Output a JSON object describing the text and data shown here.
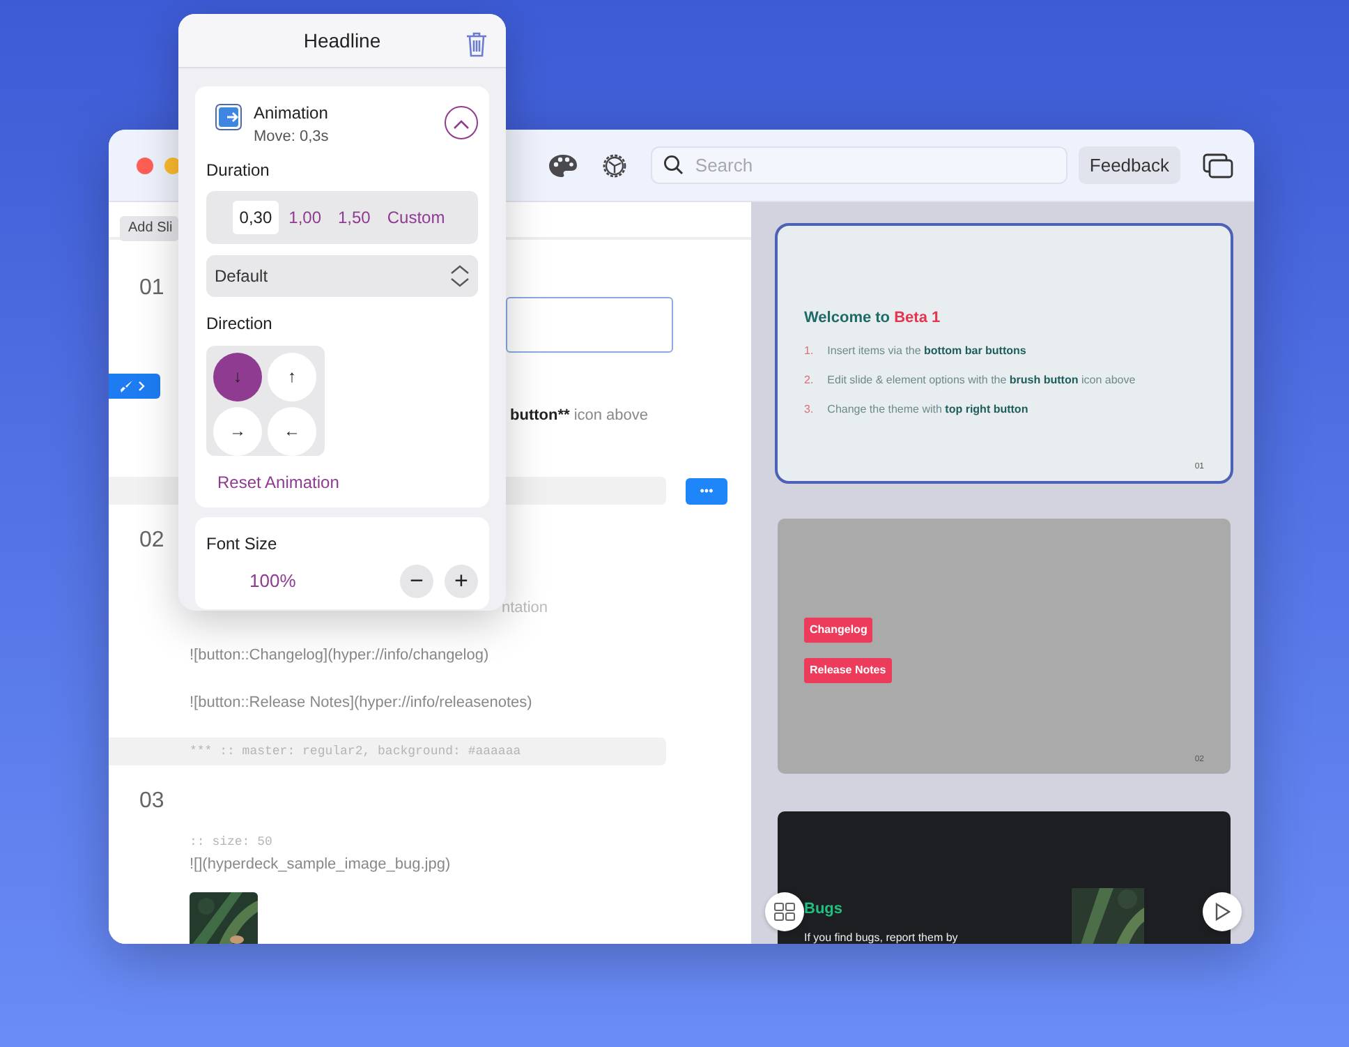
{
  "toolbar": {
    "search": {
      "placeholder": "Search"
    },
    "feedback": "Feedback"
  },
  "editor": {
    "add_slide": "Add Sli",
    "slides": [
      {
        "number": "01",
        "lines": [
          {
            "kind": "textbox"
          },
          {
            "kind": "mixed",
            "strong": "button**",
            "text": "icon above"
          },
          {
            "kind": "bar",
            "menu": "•••"
          }
        ]
      },
      {
        "number": "02",
        "lines": [
          {
            "kind": "faded",
            "text": "ntation"
          },
          {
            "kind": "text",
            "text": "![button::Changelog](hyper://info/changelog)"
          },
          {
            "kind": "text",
            "text": "![button::Release Notes](hyper://info/releasenotes)"
          },
          {
            "kind": "code_bar",
            "text": "*** :: master: regular2, background: #aaaaaa"
          }
        ]
      },
      {
        "number": "03",
        "lines": [
          {
            "kind": "code",
            "text": ":: size: 50"
          },
          {
            "kind": "text",
            "text": "![](hyperdeck_sample_image_bug.jpg)"
          },
          {
            "kind": "picture"
          }
        ]
      }
    ]
  },
  "preview": {
    "slides": [
      {
        "kind": "welcome",
        "selected": true,
        "title": "Welcome to",
        "highlight": "Beta 1",
        "number": "01",
        "items": [
          {
            "marker": "1.",
            "text": "Insert items via the **bottom bar buttons**"
          },
          {
            "marker": "2.",
            "text": "Edit slide & element options with the **brush button**  icon above"
          },
          {
            "marker": "3.",
            "text": "Change the theme with  **top right button**"
          }
        ]
      },
      {
        "kind": "buttons",
        "selected": false,
        "number": "02",
        "buttons": [
          "Changelog",
          "Release Notes"
        ]
      },
      {
        "selected": false,
        "title": "Bugs",
        "text": "If you find bugs, report them by"
      }
    ]
  },
  "popover": {
    "title": "Headline",
    "animation": {
      "title": "Animation",
      "subtitle": "Move: 0,3s",
      "expanded": true,
      "duration_label": "Duration",
      "durations": [
        {
          "label": "0,30",
          "selected": true
        },
        {
          "label": "1,00",
          "selected": false
        },
        {
          "label": "1,50",
          "selected": false
        },
        {
          "label": "Custom",
          "selected": false
        }
      ],
      "curve": "Default",
      "direction_label": "Direction",
      "directions": [
        {
          "symbol": "↓",
          "selected": true
        },
        {
          "symbol": "↑",
          "selected": false
        },
        {
          "symbol": "→",
          "selected": false
        },
        {
          "symbol": "←",
          "selected": false
        }
      ],
      "reset": "Reset Animation"
    },
    "font_size": {
      "label": "Font Size",
      "value": "100%",
      "decrease": "−",
      "increase": "+"
    }
  }
}
